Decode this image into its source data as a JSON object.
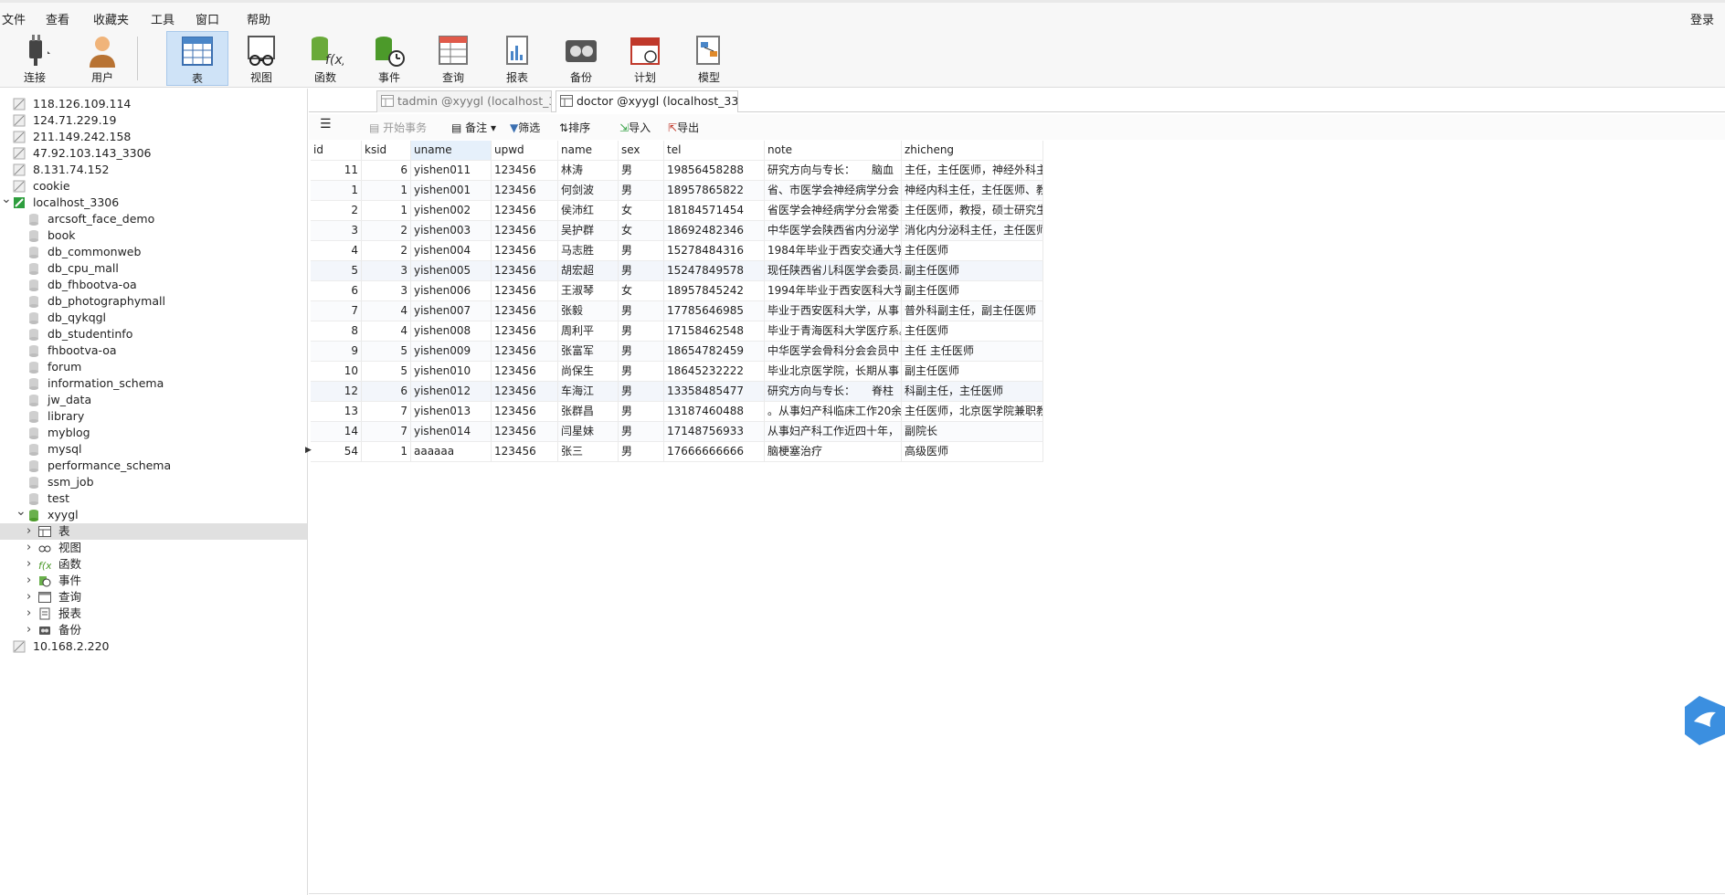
{
  "menu": {
    "file": "文件",
    "view": "查看",
    "favorites": "收藏夹",
    "tools": "工具",
    "window": "窗口",
    "help": "帮助",
    "login": "登录"
  },
  "toolbar": {
    "connect": "连接",
    "user": "用户",
    "table": "表",
    "view": "视图",
    "function": "函数",
    "event": "事件",
    "query": "查询",
    "report": "报表",
    "backup": "备份",
    "schedule": "计划",
    "model": "模型"
  },
  "sidebar": {
    "items": [
      "118.126.109.114",
      "124.71.229.19",
      "211.149.242.158",
      "47.92.103.143_3306",
      "8.131.74.152",
      "cookie",
      "localhost_3306",
      "arcsoft_face_demo",
      "book",
      "db_commonweb",
      "db_cpu_mall",
      "db_fhbootva-oa",
      "db_photographymall",
      "db_qykqgl",
      "db_studentinfo",
      "fhbootva-oa",
      "forum",
      "information_schema",
      "jw_data",
      "library",
      "myblog",
      "mysql",
      "performance_schema",
      "ssm_job",
      "test",
      "xyygl",
      "表",
      "视图",
      "函数",
      "事件",
      "查询",
      "报表",
      "备份",
      "10.168.2.220"
    ]
  },
  "tabs": {
    "tab1": "tadmin @xyygl (localhost_3...",
    "tab2": "doctor @xyygl (localhost_33..."
  },
  "objbar": {
    "begin_tx": "开始事务",
    "note": "备注",
    "filter": "筛选",
    "sort": "排序",
    "import": "导入",
    "export": "导出"
  },
  "grid": {
    "columns": [
      "id",
      "ksid",
      "uname",
      "upwd",
      "name",
      "sex",
      "tel",
      "note",
      "zhicheng"
    ],
    "rows": [
      [
        "11",
        "6",
        "yishen011",
        "123456",
        "林涛",
        "男",
        "19856458288",
        "研究方向与专长：　　脑血",
        "主任，主任医师，神经外科主"
      ],
      [
        "1",
        "1",
        "yishen001",
        "123456",
        "何剑波",
        "男",
        "18957865822",
        "省、市医学会神经病学分会",
        "神经内科主任，主任医师、教"
      ],
      [
        "2",
        "1",
        "yishen002",
        "123456",
        "侯沛红",
        "女",
        "18184571454",
        "省医学会神经病学分会常委",
        "主任医师，教授，硕士研究生"
      ],
      [
        "3",
        "2",
        "yishen003",
        "123456",
        "吴护群",
        "女",
        "18692482346",
        "中华医学会陕西省内分泌学",
        "消化内分泌科主任，主任医师"
      ],
      [
        "4",
        "2",
        "yishen004",
        "123456",
        "马志胜",
        "男",
        "15278484316",
        "1984年毕业于西安交通大学",
        "主任医师"
      ],
      [
        "5",
        "3",
        "yishen005",
        "123456",
        "胡宏超",
        "男",
        "15247849578",
        "现任陕西省儿科医学会委员、",
        "副主任医师"
      ],
      [
        "6",
        "3",
        "yishen006",
        "123456",
        "王淑琴",
        "女",
        "18957845242",
        "1994年毕业于西安医科大学",
        "副主任医师"
      ],
      [
        "7",
        "4",
        "yishen007",
        "123456",
        "张毅",
        "男",
        "17785646985",
        "毕业于西安医科大学，从事",
        "普外科副主任，副主任医师"
      ],
      [
        "8",
        "4",
        "yishen008",
        "123456",
        "周利平",
        "男",
        "17158462548",
        "毕业于青海医科大学医疗系。",
        "主任医师"
      ],
      [
        "9",
        "5",
        "yishen009",
        "123456",
        "张富军",
        "男",
        "18654782459",
        "中华医学会骨科分会会员中",
        "主任 主任医师"
      ],
      [
        "10",
        "5",
        "yishen010",
        "123456",
        "尚保生",
        "男",
        "18645232222",
        "毕业北京医学院，长期从事",
        "副主任医师"
      ],
      [
        "12",
        "6",
        "yishen012",
        "123456",
        "车海江",
        "男",
        "13358485477",
        "研究方向与专长：　　脊柱",
        "科副主任，主任医师"
      ],
      [
        "13",
        "7",
        "yishen013",
        "123456",
        "张群昌",
        "男",
        "13187460488",
        "。从事妇产科临床工作20余",
        "主任医师，北京医学院兼职教"
      ],
      [
        "14",
        "7",
        "yishen014",
        "123456",
        "闫星妹",
        "男",
        "17148756933",
        "从事妇产科工作近四十年，",
        "副院长"
      ],
      [
        "54",
        "1",
        "aaaaaa",
        "123456",
        "张三",
        "男",
        "17666666666",
        "脑梗塞治疗",
        "高级医师"
      ]
    ]
  },
  "colors": {
    "accent": "#cfe3f7",
    "selected_row": "#e0e0e0",
    "db_green": "#2e9e3e"
  }
}
